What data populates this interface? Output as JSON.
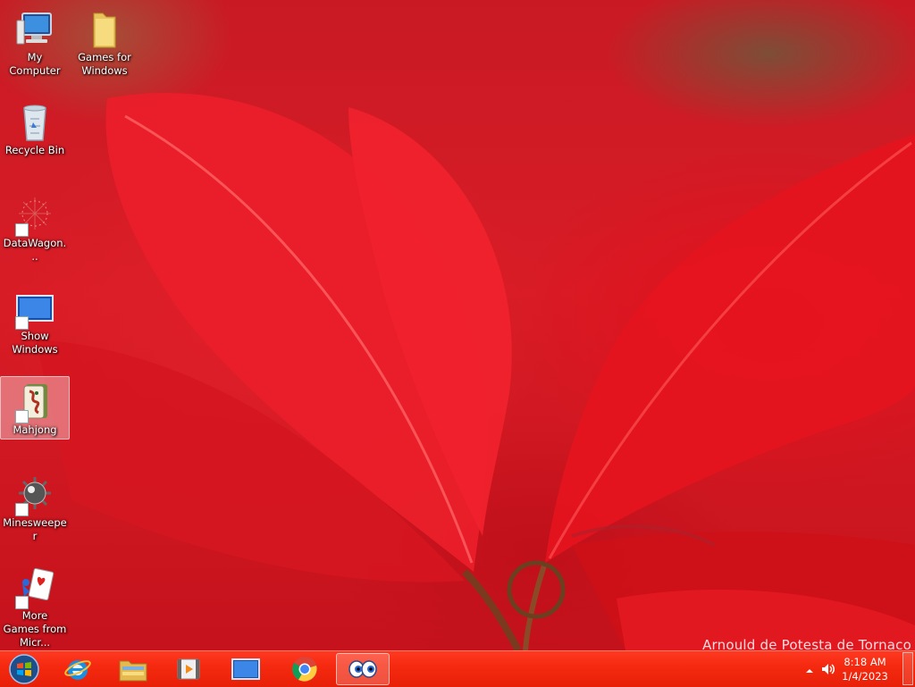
{
  "desktop": {
    "icons": [
      {
        "label": "My Computer"
      },
      {
        "label": "Games for Windows"
      },
      {
        "label": "Recycle Bin"
      },
      {
        "label": "DataWagon..."
      },
      {
        "label": "Show Windows"
      },
      {
        "label": "Mahjong"
      },
      {
        "label": "Minesweeper"
      },
      {
        "label": "More Games from Micr..."
      }
    ],
    "photo_credit": "Arnould de Potesta de Tornaco"
  },
  "taskbar": {
    "pinned": [
      {
        "icon": "windows-start-orb-icon"
      },
      {
        "icon": "internet-explorer-icon"
      },
      {
        "icon": "file-explorer-icon"
      },
      {
        "icon": "media-player-icon"
      },
      {
        "icon": "show-desktop-monitor-icon"
      },
      {
        "icon": "chrome-icon"
      },
      {
        "icon": "eyes-app-icon"
      }
    ],
    "clock": {
      "time": "8:18 AM",
      "date": "1/4/2023"
    }
  },
  "colors": {
    "taskbar": "#f52a10",
    "wallpaper_red": "#d81c26"
  }
}
